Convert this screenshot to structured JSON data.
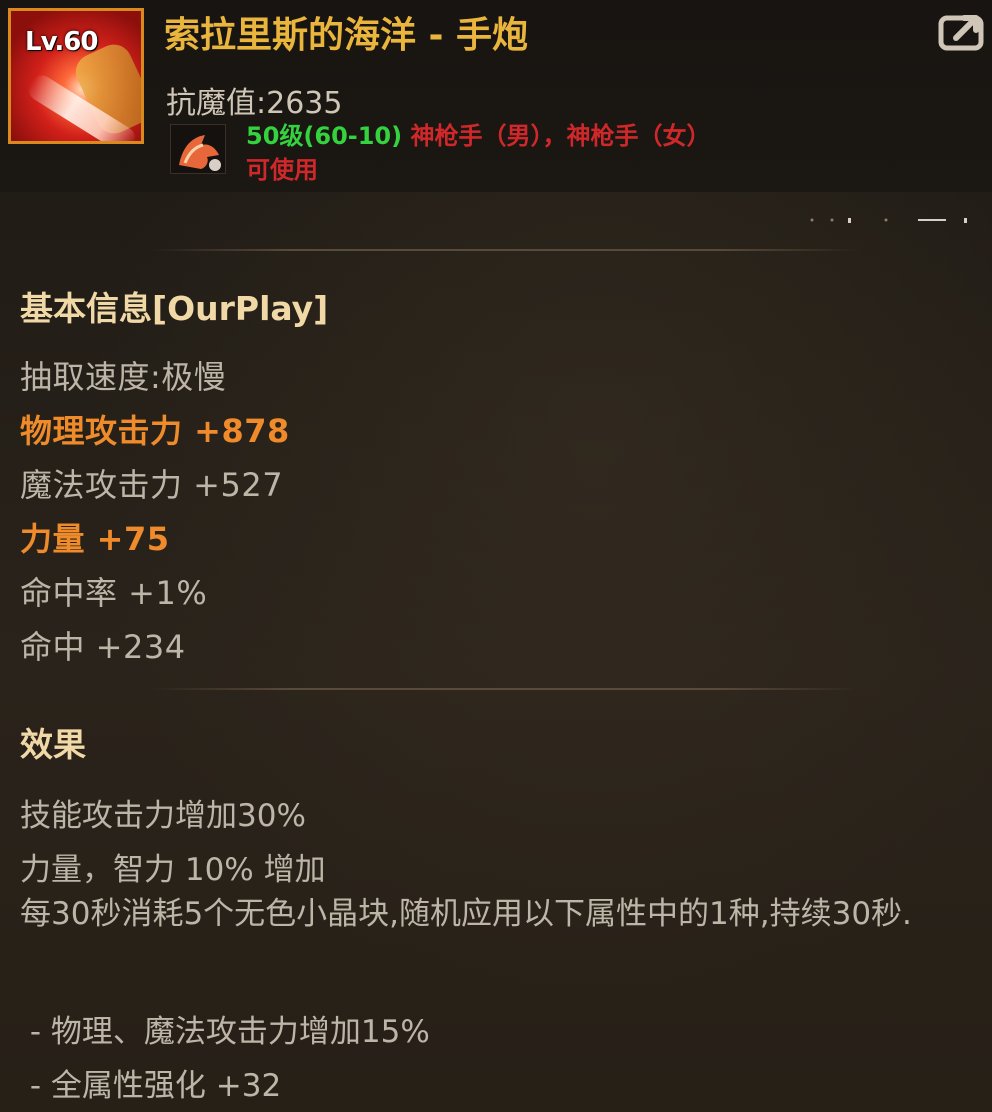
{
  "item": {
    "level_badge": "Lv.60",
    "name": "索拉里斯的海洋 - 手炮",
    "resist": "抗魔值:2635",
    "level_requirement": "50级(60-10)",
    "class_requirement": "神枪手（男），神枪手（女）",
    "usable": "可使用"
  },
  "icons": {
    "item_icon": "hand-cannon-icon",
    "class_icon": "gunner-class-icon",
    "share_icon": "share-icon"
  },
  "basic_info": {
    "title": "基本信息[OurPlay]",
    "stats": [
      {
        "text": "抽取速度:极慢",
        "highlight": false
      },
      {
        "text": "物理攻击力 +878",
        "highlight": true
      },
      {
        "text": "魔法攻击力 +527",
        "highlight": false
      },
      {
        "text": "力量 +75",
        "highlight": true
      },
      {
        "text": "命中率 +1%",
        "highlight": false
      },
      {
        "text": "命中 +234",
        "highlight": false
      }
    ]
  },
  "effects": {
    "title": "效果",
    "lines": [
      "技能攻击力增加30%",
      "力量，智力 10% 增加",
      "每30秒消耗5个无色小晶块,随机应用以下属性中的1种,持续30秒.",
      " - 物理、魔法攻击力增加15%",
      " - 全属性强化 +32"
    ]
  },
  "colors": {
    "item_name": "#e9b53d",
    "level_requirement": "#35d23f",
    "class_requirement": "#d0282a",
    "highlight_stat": "#ef8b2a",
    "normal_stat": "#bcb5a8",
    "section_title": "#f0d9a6"
  }
}
